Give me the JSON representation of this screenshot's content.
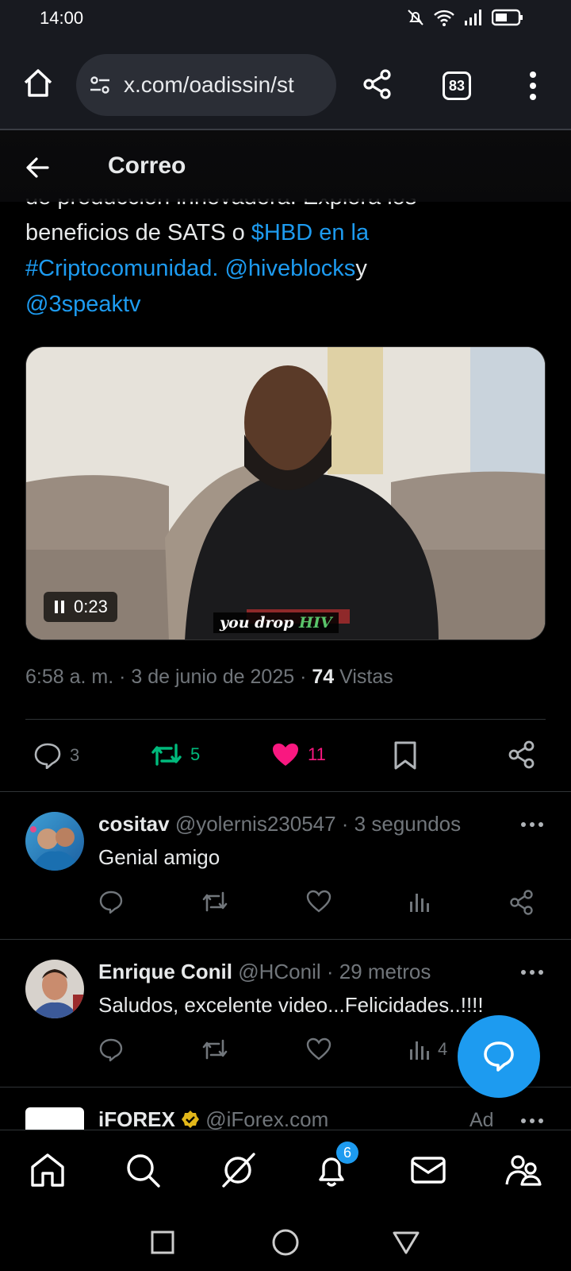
{
  "status_bar": {
    "time": "14:00"
  },
  "browser": {
    "url": "x.com/oadissin/st",
    "tab_count": "83"
  },
  "header": {
    "title": "Correo"
  },
  "tweet": {
    "text_cut": "de producción innovadora. Explora los",
    "text_plain1": "beneficios de SATS o ",
    "link1": "$HBD en la",
    "link2": "#Criptocomunidad. @hiveblocks",
    "text_plain2": "y",
    "link3": "@3speaktv",
    "video": {
      "time": "0:23",
      "caption_plain": "you drop ",
      "caption_green": "HIV"
    },
    "timestamp": "6:58 a. m. · 3 de junio de 2025 · ",
    "views_count": "74",
    "views_label": " Vistas",
    "replies": "3",
    "reposts": "5",
    "likes": "11",
    "colors": {
      "repost": "#00ba7c",
      "like": "#f91880",
      "link": "#1d9bf0"
    }
  },
  "replies": [
    {
      "name": "cositav",
      "handle": " @yolernis230547 · 3 segundos",
      "text": "Genial amigo"
    },
    {
      "name": "Enrique Conil",
      "handle": " @HConil · 29 metros",
      "text": "Saludos, excelente video...Felicidades..!!!!",
      "views": "4"
    },
    {
      "name": "iFOREX",
      "handle": " @iForex.com",
      "ad_label": "Ad"
    }
  ],
  "bottom_nav": {
    "notifications_badge": "6"
  }
}
